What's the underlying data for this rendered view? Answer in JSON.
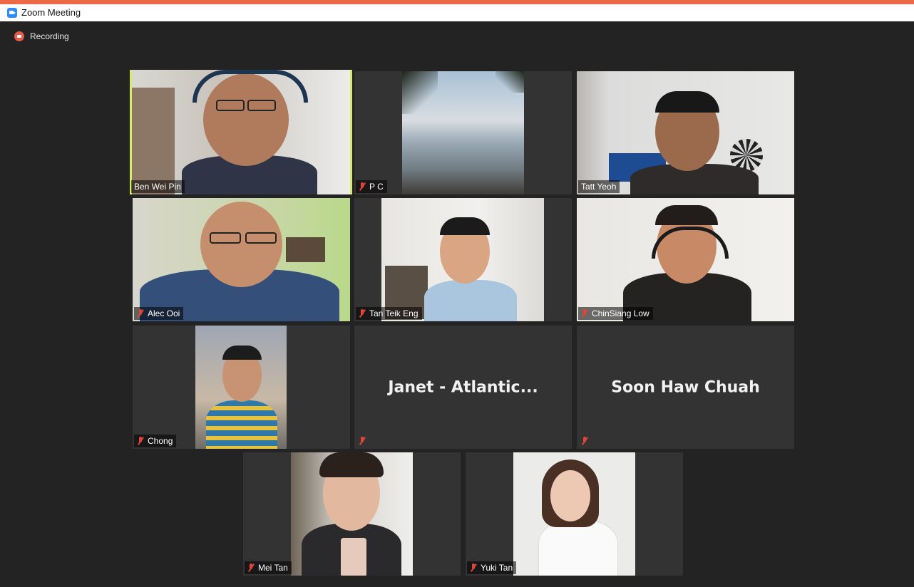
{
  "window": {
    "title": "Zoom Meeting",
    "accent": "#ec6a46"
  },
  "status": {
    "recording_label": "Recording"
  },
  "participants": [
    {
      "name": "Ben Wei Pin",
      "muted": false,
      "active_speaker": true,
      "video": true
    },
    {
      "name": "P C",
      "muted": true,
      "video": true
    },
    {
      "name": "Tatt Yeoh",
      "muted": false,
      "video": true
    },
    {
      "name": "Alec Ooi",
      "muted": true,
      "video": true
    },
    {
      "name": "Tan Teik Eng",
      "muted": true,
      "video": true
    },
    {
      "name": "ChinSiang Low",
      "muted": true,
      "video": true
    },
    {
      "name": "Chong",
      "muted": true,
      "video": true
    },
    {
      "name": "Janet - Atlantic...",
      "muted": true,
      "video": false
    },
    {
      "name": "Soon Haw Chuah",
      "muted": true,
      "video": false
    },
    {
      "name": "Mei Tan",
      "muted": true,
      "video": true
    },
    {
      "name": "Yuki Tan",
      "muted": true,
      "video": true
    }
  ]
}
